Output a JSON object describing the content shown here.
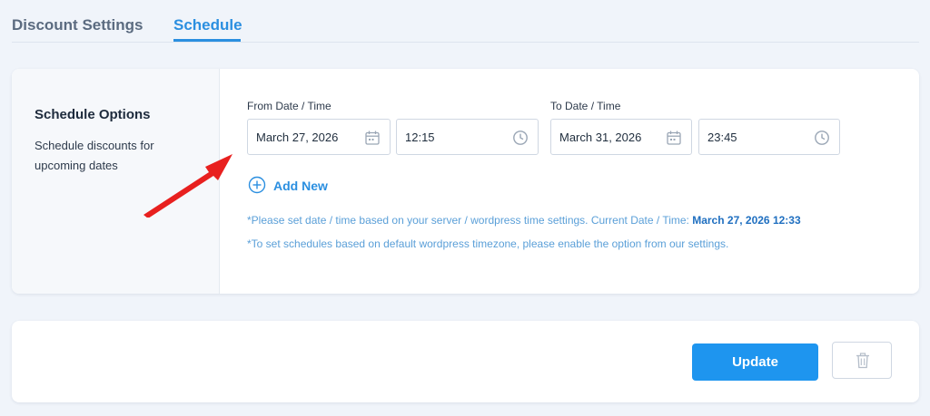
{
  "tabs": [
    {
      "label": "Discount Settings",
      "active": false
    },
    {
      "label": "Schedule",
      "active": true
    }
  ],
  "schedule": {
    "title": "Schedule Options",
    "description": "Schedule discounts for upcoming dates",
    "from": {
      "label": "From Date / Time",
      "date": "March 27, 2026",
      "time": "12:15"
    },
    "to": {
      "label": "To Date / Time",
      "date": "March 31, 2026",
      "time": "23:45"
    },
    "add_new": "Add New",
    "note1_prefix": "*Please set date / time based on your server / wordpress time settings. Current Date / Time: ",
    "note1_current": "March 27, 2026 12:33",
    "note2": "*To set schedules based on default wordpress timezone, please enable the option from our settings."
  },
  "actions": {
    "update_label": "Update",
    "delete_icon": "trash-icon"
  },
  "colors": {
    "accent": "#1e95ef",
    "arrow": "#e8201f",
    "background": "#f0f4fa"
  },
  "icons": {
    "date": "calendar-icon",
    "time": "clock-icon",
    "add": "plus-circle-icon"
  }
}
